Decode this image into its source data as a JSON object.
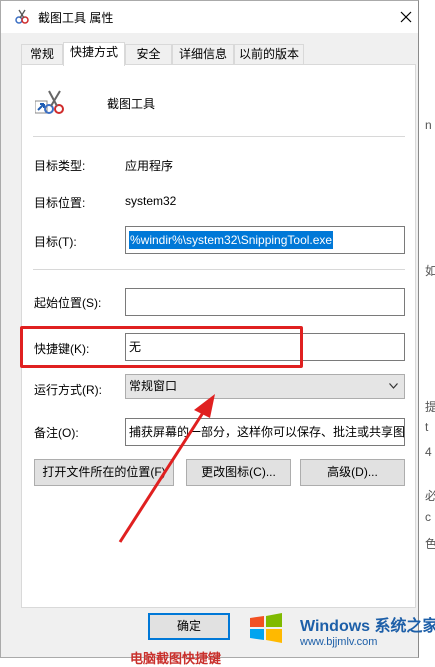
{
  "window": {
    "title": "截图工具 属性",
    "close_icon": "close-icon"
  },
  "tabs": [
    {
      "label": "常规"
    },
    {
      "label": "快捷方式"
    },
    {
      "label": "安全"
    },
    {
      "label": "详细信息"
    },
    {
      "label": "以前的版本"
    }
  ],
  "active_tab": "快捷方式",
  "shortcut": {
    "app_name": "截图工具",
    "target_type_label": "目标类型:",
    "target_type_value": "应用程序",
    "target_location_label": "目标位置:",
    "target_location_value": "system32",
    "target_label": "目标(T):",
    "target_value": "%windir%\\system32\\SnippingTool.exe",
    "start_in_label": "起始位置(S):",
    "start_in_value": "",
    "hotkey_label": "快捷键(K):",
    "hotkey_value": "无",
    "run_label": "运行方式(R):",
    "run_value": "常规窗口",
    "comment_label": "备注(O):",
    "comment_value": "捕获屏幕的一部分，这样你可以保存、批注或共享图",
    "open_location_button": "打开文件所在的位置(F)",
    "change_icon_button": "更改图标(C)...",
    "advanced_button": "高级(D)..."
  },
  "footer": {
    "ok_button": "确定"
  },
  "side_glyphs": [
    "n",
    "如",
    "提",
    "t",
    "4",
    "必",
    "c",
    "色"
  ],
  "watermark": {
    "title": "Windows 系统之家",
    "url": "www.bjjmlv.com"
  },
  "bottom_text": "电脑截图快捷键"
}
